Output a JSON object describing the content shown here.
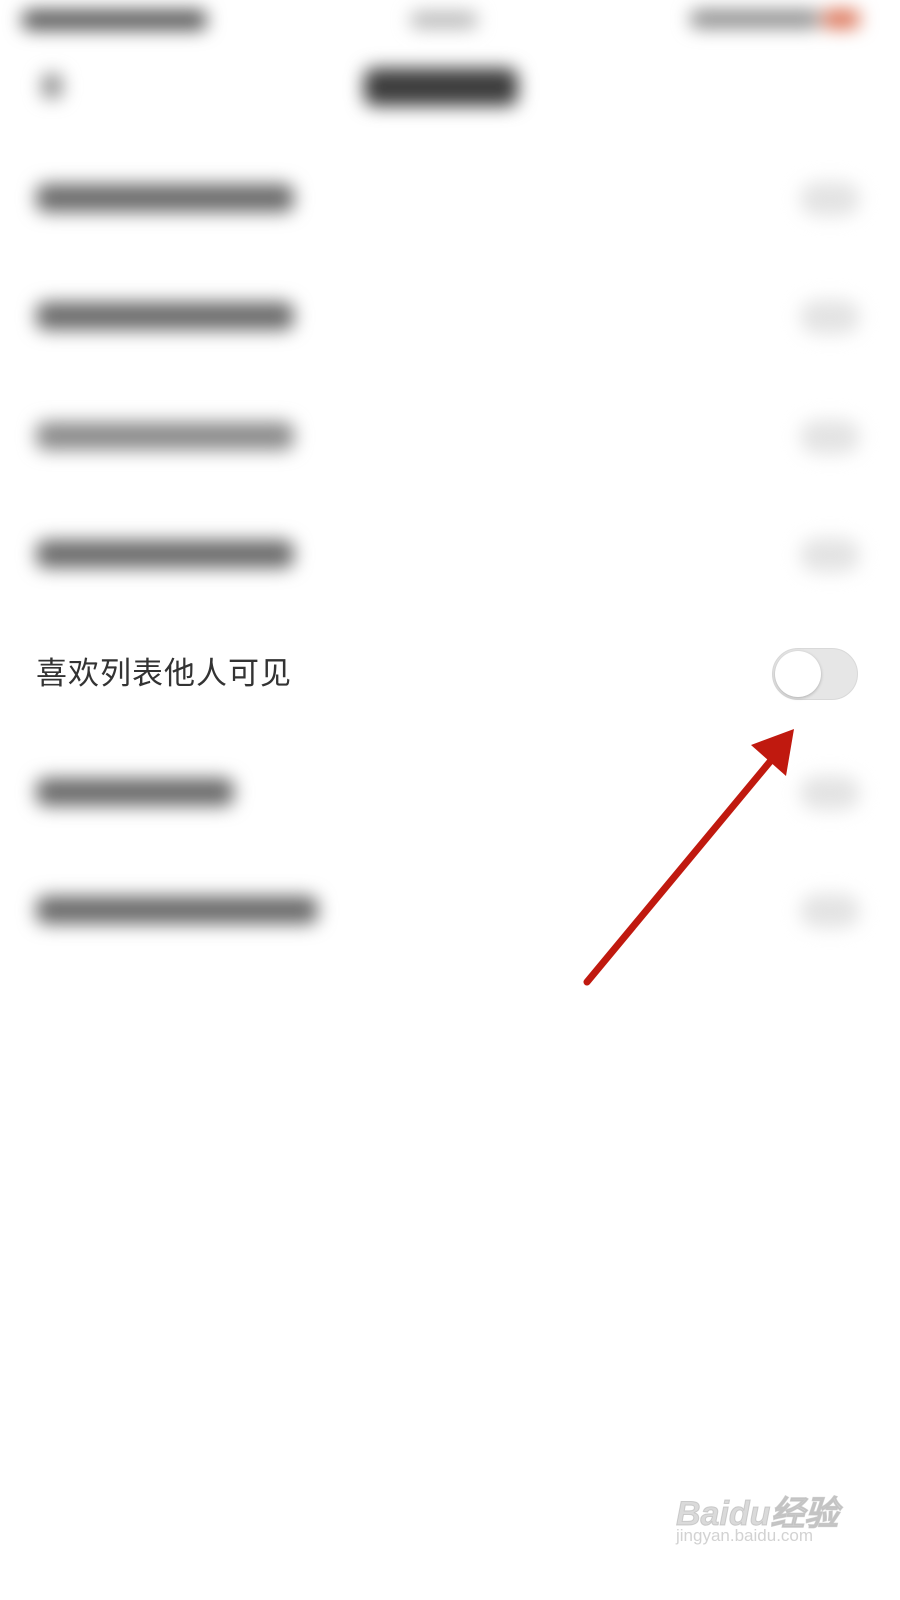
{
  "settings": {
    "like_list_visible_label": "喜欢列表他人可见",
    "like_list_visible_enabled": false
  },
  "watermark": {
    "brand": "Baidu经验",
    "url": "jingyan.baidu.com"
  },
  "colors": {
    "annotation_arrow": "#c0190f",
    "toggle_off_track": "#e6e6e6",
    "label_text": "#333333"
  },
  "icons": {
    "back": "back-arrow-icon",
    "annotation": "red-arrow-icon"
  }
}
